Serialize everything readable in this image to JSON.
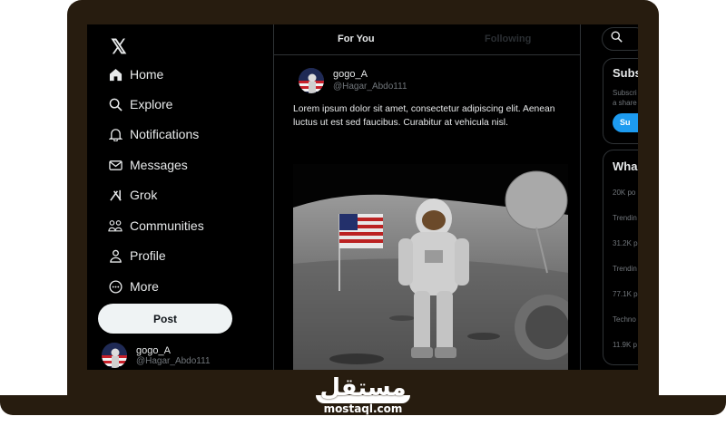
{
  "sidebar": {
    "logo": "𝕏",
    "items": [
      {
        "label": "Home",
        "icon": "home-icon"
      },
      {
        "label": "Explore",
        "icon": "search-icon"
      },
      {
        "label": "Notifications",
        "icon": "bell-icon"
      },
      {
        "label": "Messages",
        "icon": "envelope-icon"
      },
      {
        "label": "Grok",
        "icon": "grok-icon"
      },
      {
        "label": "Communities",
        "icon": "people-icon"
      },
      {
        "label": "Profile",
        "icon": "person-icon"
      },
      {
        "label": "More",
        "icon": "more-circle-icon"
      }
    ],
    "post_label": "Post",
    "user": {
      "name": "gogo_A",
      "handle": "@Hagar_Abdo111"
    }
  },
  "main": {
    "tabs": [
      {
        "label": "For You",
        "active": true
      },
      {
        "label": "Following",
        "active": false
      }
    ],
    "tweet": {
      "name": "gogo_A",
      "handle": "@Hagar_Abdo111",
      "text": "Lorem ipsum dolor sit amet, consectetur adipiscing elit. Aenean luctus ut est sed faucibus. Curabitur at vehicula nisl."
    }
  },
  "right": {
    "subscribe": {
      "title": "Subs",
      "line1": "Subscri",
      "line2": "a share",
      "button": "Su"
    },
    "whats_happening": {
      "title": "Wha",
      "trends": [
        "20K po",
        "Trendin",
        "31.2K p",
        "Trendin",
        "77.1K p",
        "Techno",
        "11.9K p"
      ]
    }
  },
  "brand": {
    "arabic": "مستقل",
    "url": "mostaql.com"
  },
  "colors": {
    "accent": "#1d9bf0",
    "bezel": "#271c0f",
    "screen_bg": "#000000",
    "muted": "#71767b",
    "text": "#e7e9ea"
  }
}
